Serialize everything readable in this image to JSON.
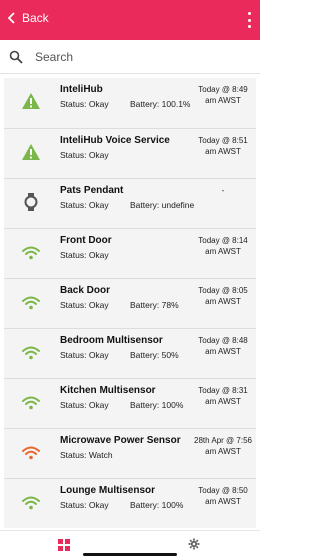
{
  "header": {
    "back_label": "Back",
    "menu_icon": "more-vertical-icon",
    "color": "#ea2a5a"
  },
  "search": {
    "placeholder": "Search",
    "icon": "search-icon"
  },
  "devices": [
    {
      "name": "InteliHub",
      "status": "Status: Okay",
      "battery": "Battery: 100.1%",
      "time": "Today @ 8:49 am AWST",
      "icon": "warning-triangle-icon",
      "icon_color": "#7ab648"
    },
    {
      "name": "InteliHub Voice Service",
      "status": "Status: Okay",
      "battery": "",
      "time": "Today @ 8:51 am AWST",
      "icon": "warning-triangle-icon",
      "icon_color": "#7ab648"
    },
    {
      "name": "Pats Pendant",
      "status": "Status: Okay",
      "battery": "Battery: undefine",
      "time": "-",
      "icon": "watch-icon",
      "icon_color": "#555555"
    },
    {
      "name": "Front Door",
      "status": "Status: Okay",
      "battery": "",
      "time": "Today @ 8:14 am AWST",
      "icon": "wifi-signal-icon",
      "icon_color": "#7ab648"
    },
    {
      "name": "Back Door",
      "status": "Status: Okay",
      "battery": "Battery: 78%",
      "time": "Today @ 8:05 am AWST",
      "icon": "wifi-signal-icon",
      "icon_color": "#7ab648"
    },
    {
      "name": "Bedroom Multisensor",
      "status": "Status: Okay",
      "battery": "Battery: 50%",
      "time": "Today @ 8:48 am AWST",
      "icon": "wifi-signal-icon",
      "icon_color": "#7ab648"
    },
    {
      "name": "Kitchen Multisensor",
      "status": "Status: Okay",
      "battery": "Battery: 100%",
      "time": "Today @ 8:31 am AWST",
      "icon": "wifi-signal-icon",
      "icon_color": "#7ab648"
    },
    {
      "name": "Microwave Power Sensor",
      "status": "Status: Watch",
      "battery": "",
      "time": "28th Apr @ 7:56 am AWST",
      "icon": "wifi-signal-icon",
      "icon_color": "#e8672e"
    },
    {
      "name": "Lounge Multisensor",
      "status": "Status: Okay",
      "battery": "Battery: 100%",
      "time": "Today @ 8:50 am AWST",
      "icon": "wifi-signal-icon",
      "icon_color": "#7ab648"
    }
  ],
  "bottom_nav": {
    "items": [
      {
        "icon": "dashboard-grid-icon",
        "active": true
      },
      {
        "icon": "settings-gear-icon",
        "active": false
      }
    ],
    "active_color": "#ea2a5a"
  }
}
